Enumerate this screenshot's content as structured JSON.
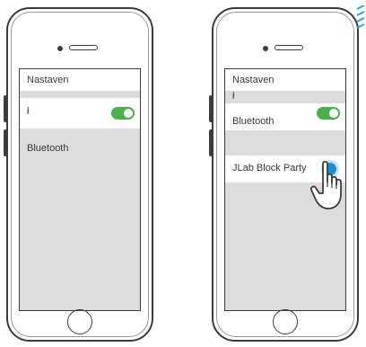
{
  "left_phone": {
    "rows": [
      {
        "label": "Nastaven"
      },
      {
        "label": "ł"
      },
      {
        "label": "Bluetooth"
      }
    ],
    "toggle_on": true
  },
  "right_phone": {
    "rows": [
      {
        "label": "Nastaven"
      },
      {
        "label": "ł"
      },
      {
        "label": "Bluetooth"
      },
      {
        "label": "JLab Block Party"
      }
    ],
    "toggle_on": true
  },
  "colors": {
    "toggle_on": "#4cae4c",
    "connect_dot": "#1a8fd6",
    "screen_bg": "#dcdcdc",
    "row_bg": "#ffffff",
    "signal": "#2aa3e0"
  }
}
